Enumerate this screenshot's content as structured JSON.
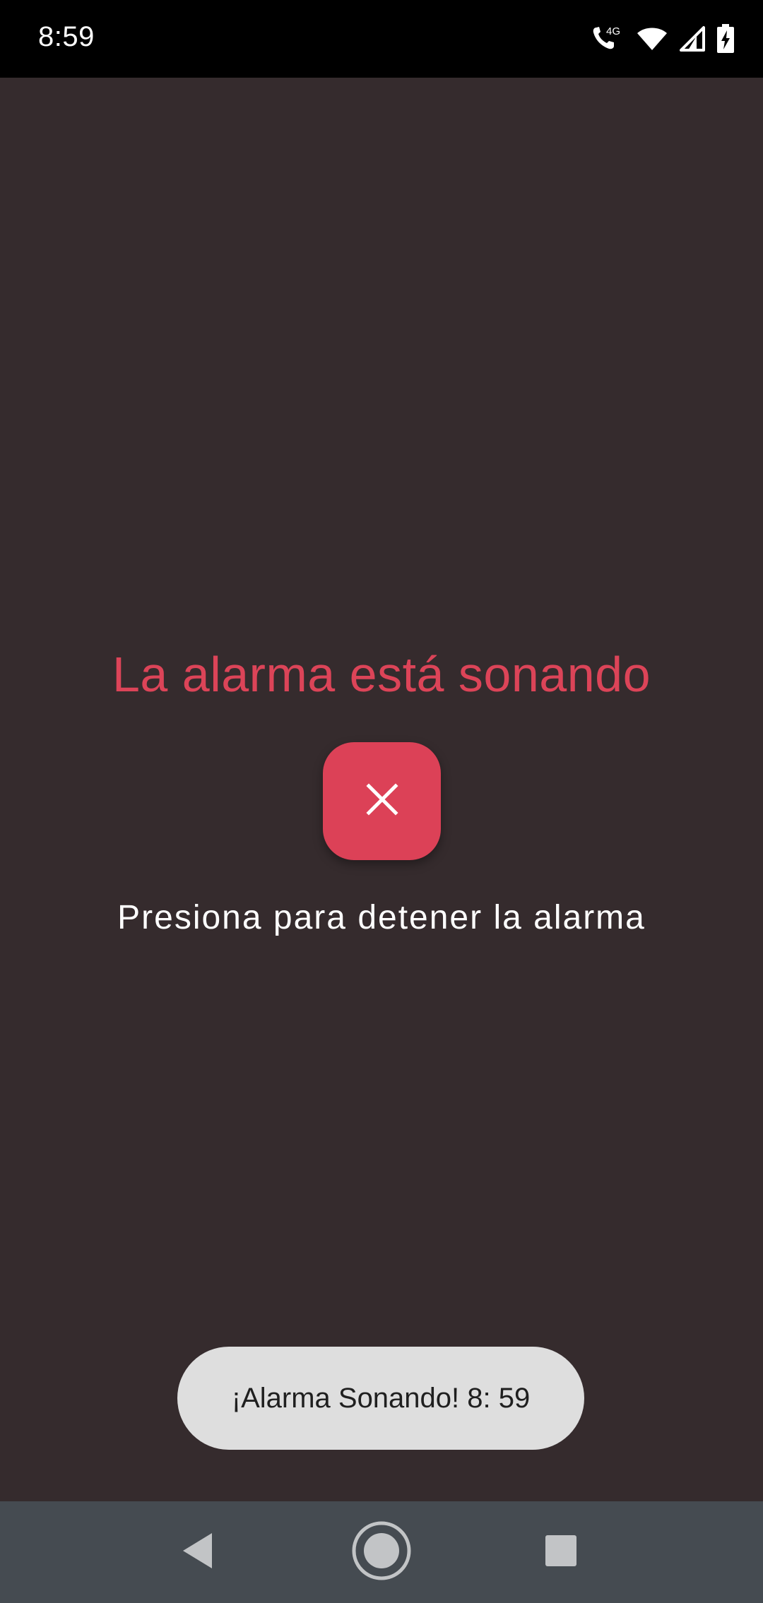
{
  "status_bar": {
    "time": "8:59",
    "icons": [
      "wifi-calling-4g-icon",
      "wifi-icon",
      "cell-signal-icon",
      "battery-charging-icon"
    ],
    "network_label": "4G"
  },
  "alarm": {
    "title": "La alarma está sonando",
    "stop_button_icon": "close-icon",
    "hint": "Presiona para detener la alarma"
  },
  "toast": {
    "message": "¡Alarma Sonando! 8: 59"
  },
  "nav_bar": {
    "buttons": [
      "back-icon",
      "home-icon",
      "recents-icon"
    ]
  },
  "colors": {
    "background": "#352b2d",
    "accent": "#dc4458",
    "status_bar": "#000000",
    "nav_bar": "#454b51",
    "toast_background": "#dedede"
  }
}
